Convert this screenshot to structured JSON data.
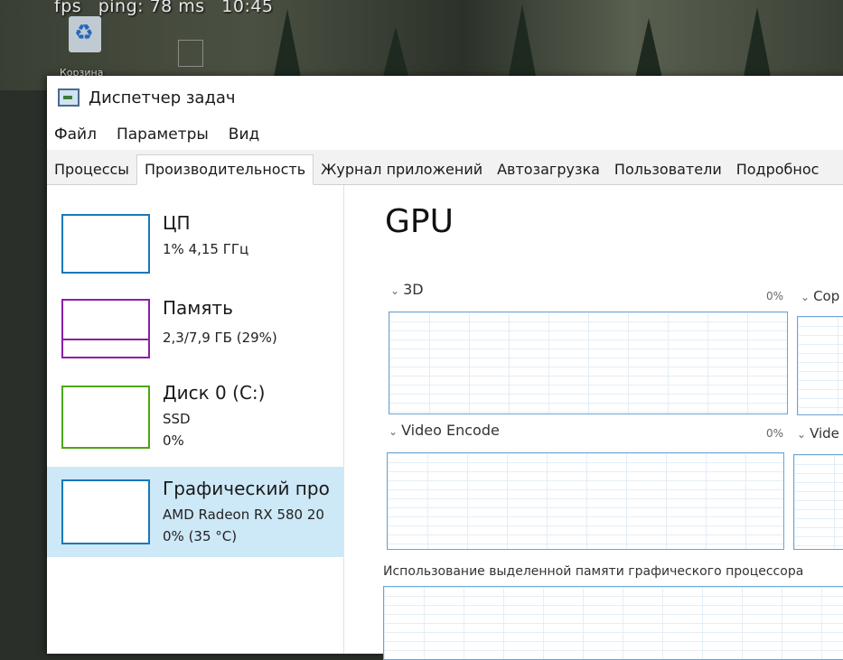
{
  "overlay": {
    "fps": "fps",
    "ping": "ping: 78 ms",
    "time": "10:45",
    "recycle_label": "Корзина"
  },
  "window": {
    "title": "Диспетчер задач"
  },
  "menu": [
    "Файл",
    "Параметры",
    "Вид"
  ],
  "tabs": [
    "Процессы",
    "Производительность",
    "Журнал приложений",
    "Автозагрузка",
    "Пользователи",
    "Подробнос"
  ],
  "resources": [
    {
      "name": "ЦП",
      "sub1": "1% 4,15 ГГц",
      "sub2": "",
      "color": "#1779ba"
    },
    {
      "name": "Память",
      "sub1": "2,3/7,9 ГБ (29%)",
      "sub2": "",
      "color": "#8b1fa8"
    },
    {
      "name": "Диск 0 (C:)",
      "sub1": "SSD",
      "sub2": "0%",
      "color": "#4da60c"
    },
    {
      "name": "Графический про",
      "sub1": "AMD Radeon RX 580 20",
      "sub2": "0% (35 °C)",
      "color": "#1779ba"
    }
  ],
  "gpu": {
    "title": "GPU",
    "graphs": [
      {
        "label": "3D",
        "pct": "0%",
        "next_label": "Cop",
        "next_pct": ""
      },
      {
        "label": "Video Encode",
        "pct": "0%",
        "next_label": "Vide",
        "next_pct": ""
      }
    ],
    "memory_label": "Использование выделенной памяти графического процессора"
  }
}
